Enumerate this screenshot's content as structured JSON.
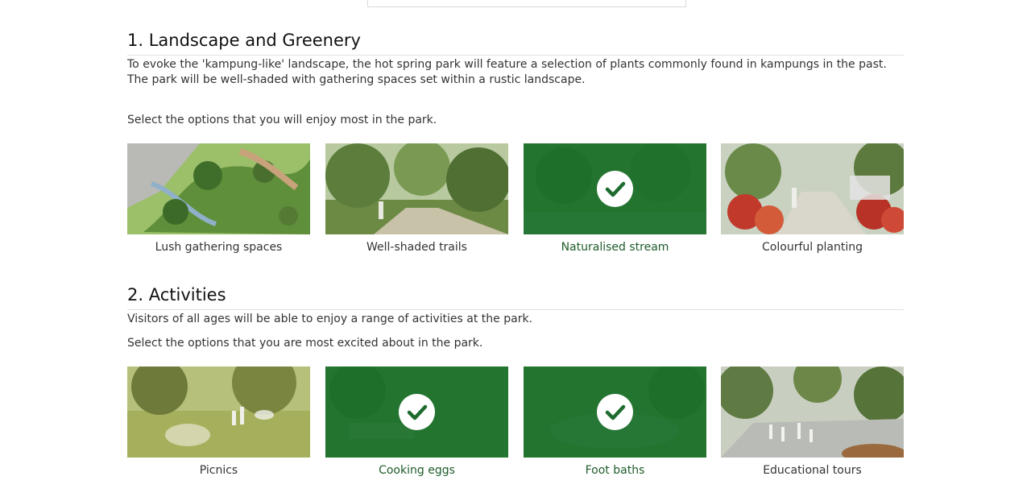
{
  "sections": [
    {
      "title": "1. Landscape and Greenery",
      "description_1": "To evoke the 'kampung-like' landscape, the hot spring park will feature a selection of plants commonly found in kampungs in the past.",
      "description_2": "The park will be well-shaded with gathering spaces set within a rustic landscape.",
      "prompt": "Select the options that you will enjoy most in the park.",
      "options": [
        {
          "label": "Lush gathering spaces",
          "selected": false
        },
        {
          "label": "Well-shaded trails",
          "selected": false
        },
        {
          "label": "Naturalised stream",
          "selected": true
        },
        {
          "label": "Colourful planting",
          "selected": false
        }
      ]
    },
    {
      "title": "2. Activities",
      "description_1": "Visitors of all ages will be able to enjoy a range of activities at the park.",
      "prompt": "Select the options that you are most excited about in the park.",
      "options": [
        {
          "label": "Picnics",
          "selected": false
        },
        {
          "label": "Cooking eggs",
          "selected": true
        },
        {
          "label": "Foot baths",
          "selected": true
        },
        {
          "label": "Educational tours",
          "selected": false
        }
      ]
    }
  ],
  "colors": {
    "selected_overlay": "#166e28",
    "selected_text": "#1e5c2a"
  }
}
